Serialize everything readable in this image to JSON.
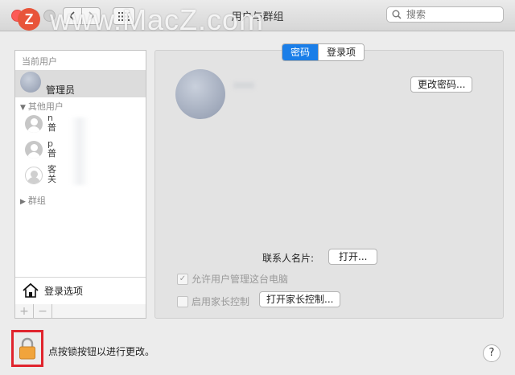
{
  "window": {
    "title": "用户与群组",
    "watermark": "www.MacZ.com",
    "logo_letter": "Z"
  },
  "toolbar": {
    "search_placeholder": "搜索"
  },
  "sidebar": {
    "current_users_header": "当前用户",
    "current_user_role": "管理员",
    "other_users_header": "其他用户",
    "other_users": [
      {
        "line1": "n",
        "line2": "普"
      },
      {
        "line1": "p",
        "line2": "普"
      },
      {
        "line1": "客",
        "line2": "关"
      }
    ],
    "groups_header": "群组",
    "login_options_label": "登录选项",
    "add_label": "+",
    "remove_label": "−"
  },
  "main": {
    "tabs": [
      {
        "label": "密码",
        "active": true
      },
      {
        "label": "登录项",
        "active": false
      }
    ],
    "change_password_button": "更改密码...",
    "contact_card_label": "联系人名片:",
    "open_button": "打开...",
    "allow_admin_label": "允许用户管理这台电脑",
    "allow_admin_checked": true,
    "parental_controls_label": "启用家长控制",
    "parental_controls_checked": false,
    "open_parental_controls_button": "打开家长控制..."
  },
  "footer": {
    "lock_text": "点按锁按钮以进行更改。",
    "help_label": "?"
  },
  "colors": {
    "accent": "#1a7ee8",
    "lock_highlight": "#e0242d",
    "close_button": "#fc5b57"
  }
}
